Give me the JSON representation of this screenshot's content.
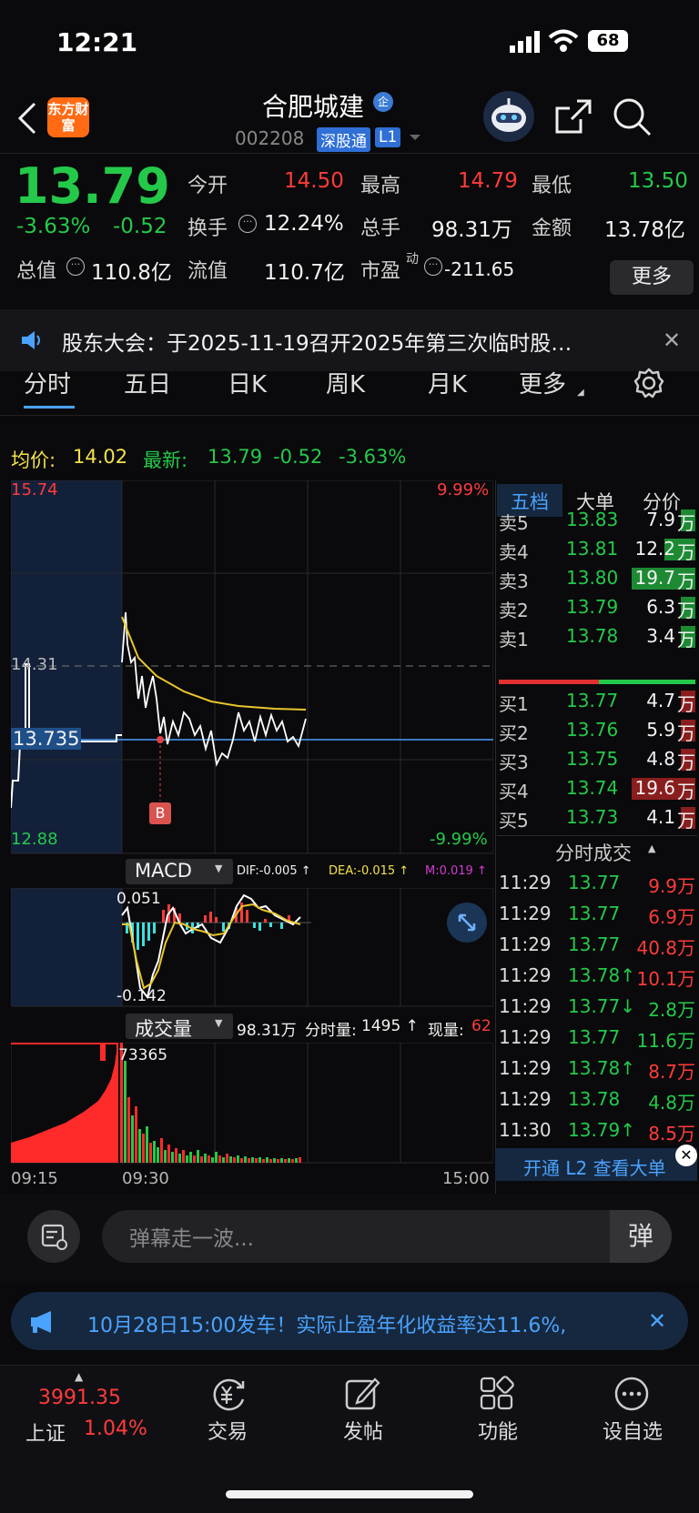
{
  "status": {
    "time": "12:21",
    "battery": "68"
  },
  "header": {
    "logo": "东方财富",
    "stock_name": "合肥城建",
    "badge": "企",
    "code": "002208",
    "market": "深股通",
    "level": "L1"
  },
  "quote": {
    "price": "13.79",
    "pct": "-3.63%",
    "chg": "-0.52",
    "open_label": "今开",
    "open": "14.50",
    "high_label": "最高",
    "high": "14.79",
    "low_label": "最低",
    "low": "13.50",
    "turnover_label": "换手",
    "turnover": "12.24%",
    "vol_label": "总手",
    "vol": "98.31万",
    "amt_label": "金额",
    "amt": "13.78亿",
    "mcap_label": "总值",
    "mcap": "110.8亿",
    "float_label": "流值",
    "float": "110.7亿",
    "pe_label": "市盈",
    "pe_sup": "动",
    "pe": "-211.65",
    "more": "更多"
  },
  "notice": {
    "text": "股东大会：于2025-11-19召开2025年第三次临时股…"
  },
  "tabs": [
    "分时",
    "五日",
    "日K",
    "周K",
    "月K",
    "更多"
  ],
  "info_line": {
    "avg_label": "均价:",
    "avg": "14.02",
    "latest_label": "最新:",
    "latest": "13.79",
    "chg": "-0.52",
    "pct": "-3.63%"
  },
  "chart": {
    "top_price": "15.74",
    "top_pct": "9.99%",
    "mid_price": "14.31",
    "cur_price": "13.735",
    "bot_price": "12.88",
    "bot_pct": "-9.99%",
    "marker": "B",
    "x_start": "09:15",
    "x_mid": "09:30",
    "x_end": "15:00"
  },
  "macd": {
    "title": "MACD",
    "dif": "DIF:-0.005 ↑",
    "dea": "DEA:-0.015 ↑",
    "m": "M:0.019 ↑",
    "top": "0.051",
    "bot": "-0.142"
  },
  "volume": {
    "title": "成交量",
    "total": "98.31万",
    "fs_label": "分时量:",
    "fs": "1495 ↑",
    "now_label": "现量:",
    "now": "62",
    "max": "73365"
  },
  "orderbook": {
    "tabs": [
      "五档",
      "大单",
      "分价"
    ],
    "asks": [
      {
        "l": "卖5",
        "p": "13.83",
        "v": "7.9",
        "u": "万"
      },
      {
        "l": "卖4",
        "p": "13.81",
        "v": "12.2",
        "u": "万"
      },
      {
        "l": "卖3",
        "p": "13.80",
        "v": "19.7",
        "u": "万"
      },
      {
        "l": "卖2",
        "p": "13.79",
        "v": "6.3",
        "u": "万"
      },
      {
        "l": "卖1",
        "p": "13.78",
        "v": "3.4",
        "u": "万"
      }
    ],
    "bids": [
      {
        "l": "买1",
        "p": "13.77",
        "v": "4.7",
        "u": "万"
      },
      {
        "l": "买2",
        "p": "13.76",
        "v": "5.9",
        "u": "万"
      },
      {
        "l": "买3",
        "p": "13.75",
        "v": "4.8",
        "u": "万"
      },
      {
        "l": "买4",
        "p": "13.74",
        "v": "19.6",
        "u": "万"
      },
      {
        "l": "买5",
        "p": "13.73",
        "v": "4.1",
        "u": "万"
      }
    ]
  },
  "trades": {
    "title": "分时成交",
    "rows": [
      {
        "t": "11:29",
        "p": "13.77",
        "v": "9.9万"
      },
      {
        "t": "11:29",
        "p": "13.77",
        "v": "6.9万"
      },
      {
        "t": "11:29",
        "p": "13.77",
        "v": "40.8万"
      },
      {
        "t": "11:29",
        "p": "13.78↑",
        "v": "10.1万"
      },
      {
        "t": "11:29",
        "p": "13.77↓",
        "v": "2.8万"
      },
      {
        "t": "11:29",
        "p": "13.77",
        "v": "11.6万"
      },
      {
        "t": "11:29",
        "p": "13.78↑",
        "v": "8.7万"
      },
      {
        "t": "11:29",
        "p": "13.78",
        "v": "4.8万"
      },
      {
        "t": "11:30",
        "p": "13.79↑",
        "v": "8.5万"
      }
    ],
    "l2": "开通 L2 查看大单"
  },
  "danmu": {
    "placeholder": "弹幕走一波...",
    "btn": "弹"
  },
  "promo": {
    "text": "10月28日15:00发车！实际止盈年化收益率达11.6%,"
  },
  "nav": {
    "index_value": "3991.35",
    "index_name": "上证",
    "index_pct": "1.04%",
    "items": [
      "交易",
      "发帖",
      "功能",
      "设自选"
    ]
  }
}
